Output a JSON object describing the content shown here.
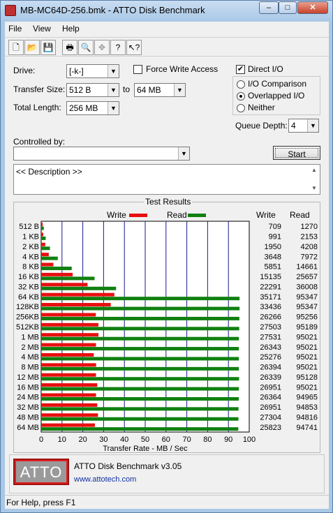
{
  "window": {
    "title": "MB-MC64D-256.bmk - ATTO Disk Benchmark"
  },
  "window_controls": {
    "minimize": "–",
    "maximize": "□",
    "close": "✕"
  },
  "menu": [
    "File",
    "View",
    "Help"
  ],
  "toolbar": [
    "new-file-icon",
    "open-folder-icon",
    "save-icon",
    "print-icon",
    "print-preview-icon",
    "move-icon",
    "help-icon",
    "context-help-icon"
  ],
  "toolbar_glyphs": [
    "🗋",
    "📂",
    "💾",
    "🖶",
    "🔍",
    "✥",
    "?",
    "↖?"
  ],
  "settings": {
    "drive_label": "Drive:",
    "drive_value": "[-k-]",
    "transfer_size_label": "Transfer Size:",
    "transfer_from": "512 B",
    "to_label": "to",
    "transfer_to": "64 MB",
    "total_length_label": "Total Length:",
    "total_length": "256 MB",
    "force_write_label": "Force Write Access",
    "direct_io_label": "Direct I/O",
    "direct_io_checked": "✔",
    "io_comparison_label": "I/O Comparison",
    "overlapped_io_label": "Overlapped I/O",
    "neither_label": "Neither",
    "queue_depth_label": "Queue Depth:",
    "queue_depth": "4",
    "controlled_by_label": "Controlled by:",
    "controlled_by_value": "",
    "start_label": "Start",
    "description": "<< Description >>"
  },
  "results": {
    "title": "Test Results",
    "write_legend": "Write",
    "read_legend": "Read",
    "write_col": "Write",
    "read_col": "Read"
  },
  "chart_data": {
    "type": "bar",
    "orientation": "horizontal",
    "categories": [
      "512 B",
      "1 KB",
      "2 KB",
      "4 KB",
      "8 KB",
      "16 KB",
      "32 KB",
      "64 KB",
      "128KB",
      "256KB",
      "512KB",
      "1 MB",
      "2 MB",
      "4 MB",
      "8 MB",
      "12 MB",
      "16 MB",
      "24 MB",
      "32 MB",
      "48 MB",
      "64 MB"
    ],
    "series": [
      {
        "name": "Write",
        "color": "#e81010",
        "values": [
          709,
          991,
          1950,
          3648,
          5851,
          15135,
          22291,
          35171,
          33436,
          26266,
          27503,
          27531,
          26343,
          25276,
          26394,
          26339,
          26951,
          26364,
          26951,
          27304,
          25823
        ]
      },
      {
        "name": "Read",
        "color": "#108010",
        "values": [
          1270,
          2153,
          4208,
          7972,
          14661,
          25657,
          36008,
          95347,
          95347,
          95256,
          95189,
          95021,
          95021,
          95021,
          95021,
          95128,
          95021,
          94965,
          94853,
          94816,
          94741
        ]
      }
    ],
    "xlabel": "Transfer Rate - MB / Sec",
    "xlim": [
      0,
      100
    ],
    "xticks": [
      "0",
      "10",
      "20",
      "30",
      "40",
      "50",
      "60",
      "70",
      "80",
      "90",
      "100"
    ],
    "grid": true
  },
  "footer": {
    "logo": "ATTO",
    "product": "ATTO Disk Benchmark v3.05",
    "url": "www.attotech.com"
  },
  "status": "For Help, press F1"
}
